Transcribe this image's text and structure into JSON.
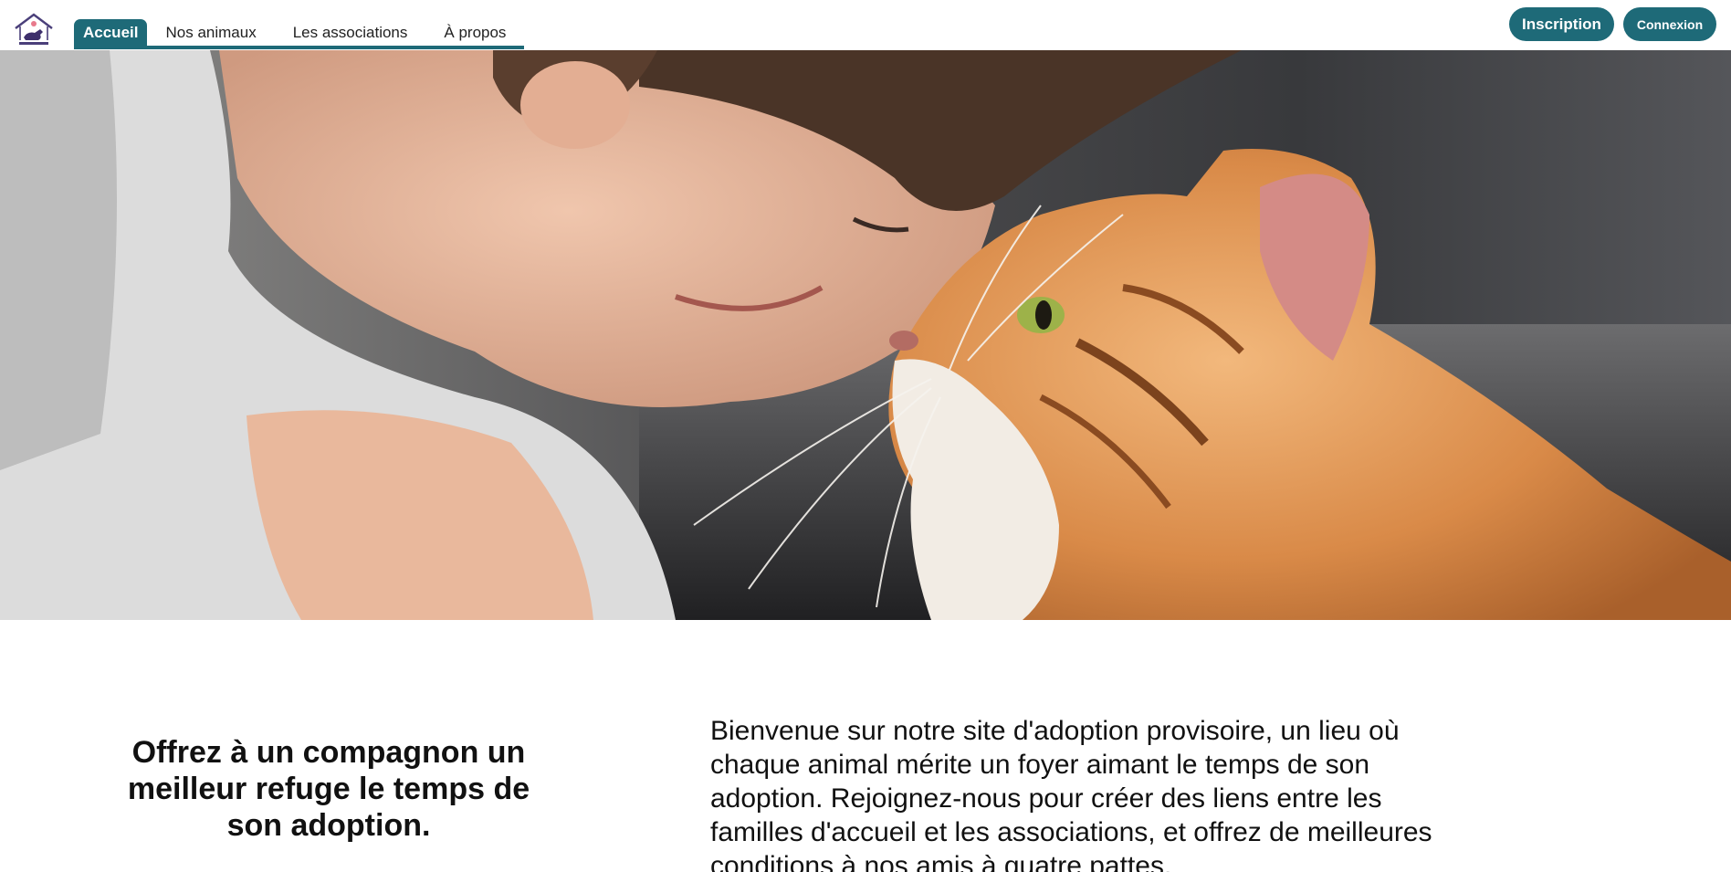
{
  "header": {
    "logo_icon": "house-dog-logo",
    "nav": [
      {
        "label": "Accueil",
        "active": true
      },
      {
        "label": "Nos animaux",
        "active": false
      },
      {
        "label": "Les associations",
        "active": false
      },
      {
        "label": "À propos",
        "active": false
      }
    ],
    "signup_label": "Inscription",
    "login_label": "Connexion"
  },
  "hero": {
    "image": "woman-and-ginger-cat-photo"
  },
  "intro": {
    "tagline": "Offrez à un compagnon un meilleur refuge le temps de son adoption.",
    "welcome": "Bienvenue sur notre site d'adoption provisoire, un lieu où chaque animal mérite un foyer aimant le temps de son adoption. Rejoignez-nous pour créer des liens entre les familles d'accueil et les associations, et offrez de meilleures conditions à nos amis à quatre pattes."
  },
  "colors": {
    "accent": "#1e6a78",
    "text": "#111111",
    "background": "#ffffff"
  }
}
